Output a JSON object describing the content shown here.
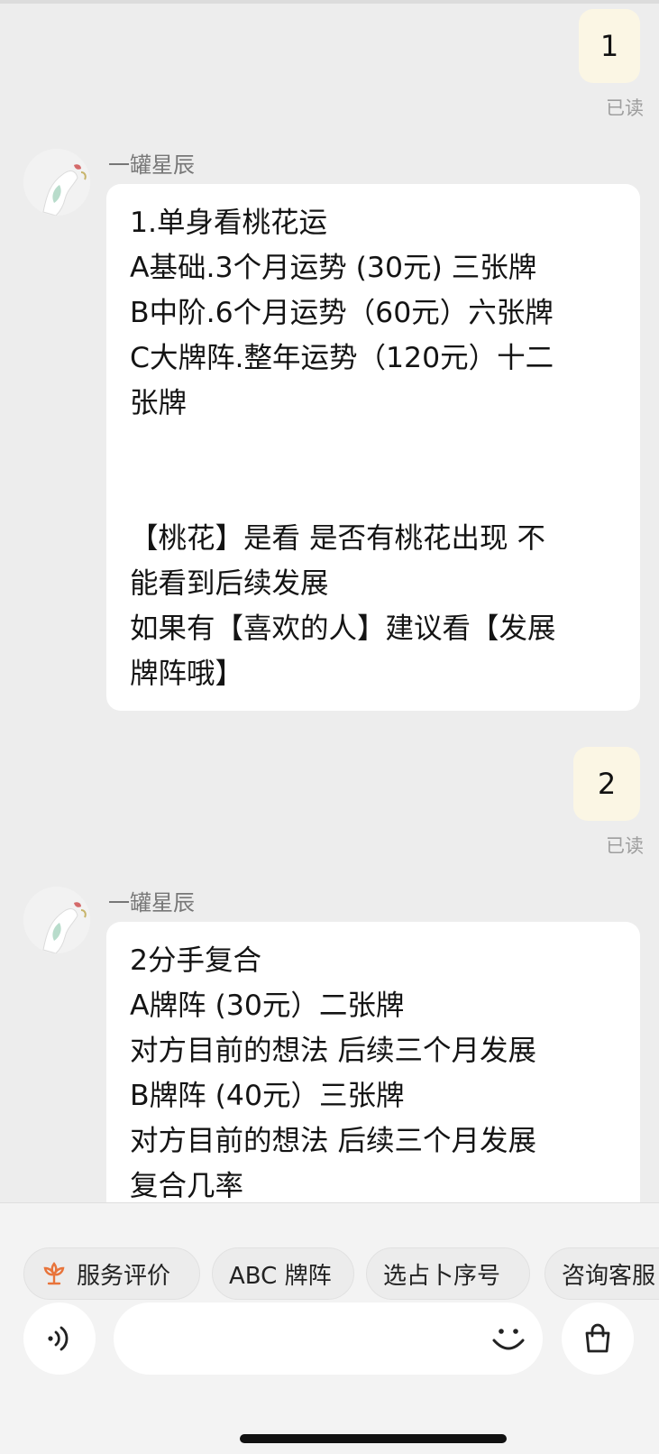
{
  "messages": {
    "out1": {
      "text": "1",
      "status": "已读"
    },
    "in1": {
      "sender": "一罐星辰",
      "lines": [
        "1.单身看桃花运",
        "A基础.3个月运势 (30元) 三张牌",
        "B中阶.6个月运势（60元）六张牌",
        "C大牌阵.整年运势（120元）十二",
        "张牌",
        "",
        "",
        "【桃花】是看 是否有桃花出现 不",
        "能看到后续发展",
        "如果有【喜欢的人】建议看【发展",
        "牌阵哦】"
      ]
    },
    "out2": {
      "text": "2",
      "status": "已读"
    },
    "in2": {
      "sender": "一罐星辰",
      "lines": [
        "2分手复合",
        "A牌阵 (30元）二张牌",
        "对方目前的想法  后续三个月发展",
        "B牌阵 (40元）三张牌",
        "对方目前的想法  后续三个月发展",
        "复合几率"
      ]
    }
  },
  "quick_replies": [
    {
      "label": "服务评价",
      "icon": "flower-icon"
    },
    {
      "label": "ABC 牌阵"
    },
    {
      "label": "选占卜序号"
    },
    {
      "label": "咨询客服"
    }
  ],
  "input_bar": {
    "voice_icon": "voice-icon",
    "emoji_icon": "smiley-icon",
    "shop_icon": "shopping-bag-icon"
  },
  "colors": {
    "background": "#ededed",
    "outgoing_bubble": "#fbf6e4",
    "incoming_bubble": "#ffffff",
    "accent": "#e8743b"
  }
}
